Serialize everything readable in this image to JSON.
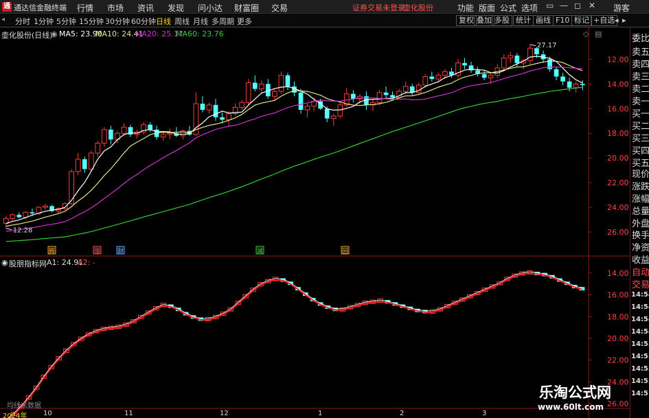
{
  "app": {
    "title": "通达信金融终端",
    "menu": [
      "行情",
      "市场",
      "资讯",
      "发现",
      "问小达",
      "财富圈",
      "交易"
    ],
    "status_login": "证券交易未登录",
    "status_stock": "壶化股份",
    "right_menu": [
      "功能",
      "版面",
      "公式",
      "选项"
    ],
    "guest": "游客",
    "window_controls": [
      "▭",
      "—",
      "◻",
      "✕"
    ]
  },
  "toolbar": {
    "periods": [
      "分时",
      "1分钟",
      "5分钟",
      "15分钟",
      "30分钟",
      "60分钟",
      "日线",
      "周线",
      "月线",
      "多周期",
      "更多"
    ],
    "active_period": "日线",
    "right_buttons": [
      "复权",
      "叠加",
      "多股",
      "统计",
      "画线",
      "F10",
      "标记",
      "+自选"
    ],
    "right_arrows": [
      "◂",
      "▸"
    ]
  },
  "main_chart": {
    "stock_label": "壶化股份(日线)",
    "ma5": "MA5: 23.90",
    "ma10": "MA10: 24.41",
    "ma20": "MA20: 25.17",
    "ma60": "MA60: 23.76",
    "high_label": "27.17",
    "low_label": "12.28",
    "y_ticks": [
      "26.00",
      "24.00",
      "22.00",
      "20.00",
      "18.00",
      "16.00",
      "14.00",
      "12.00"
    ],
    "markers": [
      "腾",
      "涨",
      "财",
      "减",
      "回"
    ],
    "colors": {
      "up": "#ff3c3c",
      "down": "#54ffff",
      "ma5": "#ffffff",
      "ma10": "#e6e68a",
      "ma20": "#cc33cc",
      "ma60": "#33cc33"
    }
  },
  "indicator": {
    "name": "股朋指标网",
    "a1": "A1: 24.91",
    "a2": "A2: -",
    "y_ticks": [
      "26.00",
      "24.00",
      "22.00",
      "20.00",
      "18.00",
      "16.00",
      "14.00"
    ]
  },
  "side_panel": {
    "labels": [
      "委比",
      "卖五",
      "卖四",
      "卖三",
      "卖二",
      "卖一",
      "买一",
      "买二",
      "买三",
      "买四",
      "买五",
      "现价",
      "涨跌",
      "涨幅",
      "总量",
      "外盘",
      "换手",
      "净资",
      "收益"
    ],
    "indicator_labels": [
      "自动",
      "交易"
    ],
    "times": [
      "14:54",
      "14:54",
      "14:54",
      "14:54",
      "14:55",
      "14:55",
      "14:55",
      "14:55",
      "14:5"
    ]
  },
  "bottom": {
    "no_data": "均线未数据",
    "dates": [
      "2024年",
      "10",
      "11",
      "12",
      "1",
      "2",
      "3"
    ]
  },
  "watermark": {
    "cn": "乐淘公式网",
    "url": "www.60lt.com"
  },
  "chart_data": [
    {
      "type": "candlestick",
      "title": "壶化股份(日线)",
      "ylim": [
        10.5,
        27.8
      ],
      "y_ticks": [
        12,
        14,
        16,
        18,
        20,
        22,
        24,
        26
      ],
      "x_labels": [
        "2024年",
        "10",
        "11",
        "12",
        "1",
        "2",
        "3"
      ],
      "ohlc": [
        [
          12.7,
          13.3,
          12.3,
          13.1
        ],
        [
          13.1,
          13.5,
          12.9,
          13.4
        ],
        [
          13.4,
          13.6,
          13.1,
          13.2
        ],
        [
          13.2,
          13.7,
          13.0,
          13.6
        ],
        [
          13.6,
          13.9,
          13.3,
          13.5
        ],
        [
          13.5,
          14.1,
          13.4,
          14.0
        ],
        [
          14.0,
          14.3,
          13.8,
          14.1
        ],
        [
          14.1,
          14.2,
          13.6,
          13.7
        ],
        [
          13.7,
          14.0,
          13.5,
          13.9
        ],
        [
          13.9,
          14.4,
          13.8,
          14.3
        ],
        [
          14.3,
          17.1,
          14.2,
          16.9
        ],
        [
          16.9,
          18.4,
          16.6,
          17.9
        ],
        [
          17.9,
          18.1,
          16.8,
          17.1
        ],
        [
          17.1,
          18.6,
          16.9,
          18.4
        ],
        [
          18.4,
          19.4,
          18.1,
          19.2
        ],
        [
          19.2,
          20.5,
          18.9,
          20.3
        ],
        [
          20.3,
          20.6,
          19.1,
          19.5
        ],
        [
          19.5,
          20.2,
          19.2,
          20.0
        ],
        [
          20.0,
          20.8,
          19.8,
          20.5
        ],
        [
          20.5,
          20.7,
          19.7,
          19.9
        ],
        [
          19.9,
          20.3,
          19.6,
          20.1
        ],
        [
          20.1,
          20.9,
          19.9,
          20.7
        ],
        [
          20.7,
          20.9,
          20.1,
          20.3
        ],
        [
          20.3,
          20.6,
          19.5,
          19.7
        ],
        [
          19.7,
          20.2,
          19.4,
          19.9
        ],
        [
          19.9,
          20.4,
          19.5,
          20.0
        ],
        [
          20.0,
          20.5,
          19.7,
          19.8
        ],
        [
          19.8,
          20.3,
          19.5,
          20.2
        ],
        [
          20.2,
          20.6,
          19.8,
          19.9
        ],
        [
          19.9,
          23.3,
          19.8,
          22.4
        ],
        [
          22.4,
          23.0,
          21.7,
          21.9
        ],
        [
          21.9,
          22.5,
          21.6,
          22.3
        ],
        [
          22.3,
          22.8,
          21.0,
          21.3
        ],
        [
          21.3,
          21.7,
          20.8,
          21.1
        ],
        [
          21.1,
          21.8,
          20.6,
          21.6
        ],
        [
          21.6,
          22.4,
          21.4,
          22.1
        ],
        [
          22.1,
          22.7,
          21.9,
          22.5
        ],
        [
          22.5,
          24.4,
          22.3,
          24.1
        ],
        [
          24.1,
          24.7,
          23.4,
          23.6
        ],
        [
          23.6,
          24.3,
          23.2,
          24.0
        ],
        [
          24.0,
          24.4,
          22.8,
          23.0
        ],
        [
          23.0,
          23.6,
          22.6,
          23.4
        ],
        [
          23.4,
          25.0,
          23.2,
          24.7
        ],
        [
          24.7,
          24.9,
          23.5,
          23.8
        ],
        [
          23.8,
          24.2,
          23.0,
          23.3
        ],
        [
          23.3,
          23.6,
          21.6,
          21.9
        ],
        [
          21.9,
          22.4,
          21.3,
          22.2
        ],
        [
          22.2,
          22.9,
          21.8,
          22.6
        ],
        [
          22.6,
          22.8,
          21.9,
          22.0
        ],
        [
          22.0,
          22.2,
          20.9,
          21.2
        ],
        [
          21.2,
          21.6,
          20.6,
          21.4
        ],
        [
          21.4,
          22.5,
          21.2,
          22.3
        ],
        [
          22.3,
          23.7,
          22.1,
          23.2
        ],
        [
          23.2,
          23.5,
          22.5,
          22.8
        ],
        [
          22.8,
          23.2,
          22.4,
          23.0
        ],
        [
          23.0,
          23.4,
          21.9,
          22.3
        ],
        [
          22.3,
          22.8,
          21.8,
          22.5
        ],
        [
          22.5,
          23.5,
          22.3,
          23.3
        ],
        [
          23.3,
          23.8,
          22.9,
          23.1
        ],
        [
          23.1,
          23.4,
          22.7,
          22.9
        ],
        [
          22.9,
          23.6,
          22.8,
          23.4
        ],
        [
          23.4,
          24.2,
          23.2,
          23.8
        ],
        [
          23.8,
          24.0,
          23.1,
          23.3
        ],
        [
          23.3,
          24.1,
          23.2,
          23.9
        ],
        [
          23.9,
          24.8,
          23.7,
          24.6
        ],
        [
          24.6,
          25.0,
          24.2,
          24.4
        ],
        [
          24.4,
          24.9,
          24.2,
          24.7
        ],
        [
          24.7,
          25.2,
          24.4,
          25.0
        ],
        [
          25.0,
          25.3,
          24.5,
          24.7
        ],
        [
          24.7,
          26.0,
          24.5,
          25.7
        ],
        [
          25.7,
          26.1,
          25.2,
          25.5
        ],
        [
          25.5,
          25.8,
          24.9,
          25.1
        ],
        [
          25.1,
          25.4,
          24.6,
          24.8
        ],
        [
          24.8,
          25.1,
          24.3,
          24.5
        ],
        [
          24.5,
          24.9,
          24.0,
          24.7
        ],
        [
          24.7,
          25.6,
          24.5,
          25.3
        ],
        [
          25.3,
          26.4,
          25.1,
          26.1
        ],
        [
          26.1,
          26.6,
          25.7,
          26.3
        ],
        [
          26.3,
          26.5,
          25.4,
          25.7
        ],
        [
          25.7,
          26.0,
          25.2,
          25.9
        ],
        [
          25.9,
          27.2,
          25.6,
          26.9
        ],
        [
          26.9,
          27.0,
          26.1,
          26.4
        ],
        [
          26.4,
          26.7,
          25.7,
          26.0
        ],
        [
          26.0,
          26.2,
          25.0,
          25.2
        ],
        [
          25.2,
          25.4,
          24.3,
          24.6
        ],
        [
          24.6,
          24.9,
          23.9,
          24.2
        ],
        [
          24.2,
          24.5,
          23.4,
          23.7
        ],
        [
          23.7,
          24.2,
          23.3,
          24.0
        ],
        [
          24.0,
          24.3,
          23.5,
          23.9
        ]
      ]
    },
    {
      "type": "line",
      "title": "股朋指标网",
      "series": [
        {
          "name": "A1",
          "values": [
            12.4,
            13.0,
            13.7,
            14.5,
            15.4,
            16.4,
            17.3,
            18.1,
            18.8,
            19.4,
            19.9,
            20.3,
            20.6,
            20.8,
            20.9,
            21.0,
            21.2,
            21.5,
            21.9,
            22.3,
            22.7,
            23.0,
            22.9,
            22.6,
            22.2,
            21.9,
            21.7,
            21.7,
            21.9,
            22.2,
            22.6,
            23.2,
            23.8,
            24.4,
            24.9,
            25.2,
            25.4,
            25.3,
            25.0,
            24.5,
            24.0,
            23.5,
            23.1,
            22.8,
            22.6,
            22.6,
            22.8,
            23.0,
            23.2,
            23.3,
            23.4,
            23.3,
            23.1,
            22.9,
            22.7,
            22.5,
            22.4,
            22.4,
            22.6,
            22.9,
            23.2,
            23.5,
            23.8,
            24.1,
            24.4,
            24.7,
            25.0,
            25.4,
            25.7,
            25.9,
            26.0,
            25.9,
            25.8,
            25.6,
            25.3,
            25.0,
            24.7,
            24.5
          ]
        }
      ],
      "ylim": [
        13.5,
        27.0
      ],
      "y_ticks": [
        14,
        16,
        18,
        20,
        22,
        24,
        26
      ]
    }
  ]
}
